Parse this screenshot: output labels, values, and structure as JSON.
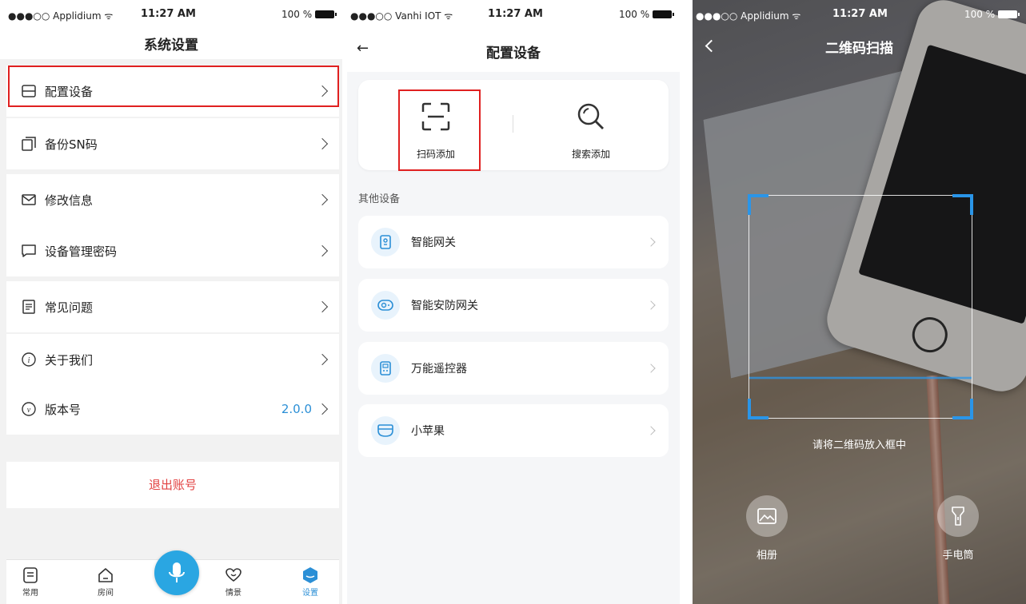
{
  "screen1": {
    "status": {
      "carrier": "●●●○○ Applidium ᯤ",
      "time": "11:27 AM",
      "battery": "100 %"
    },
    "title": "系统设置",
    "menu": [
      {
        "label": "配置设备",
        "icon": "device-icon"
      },
      {
        "label": "备份SN码",
        "icon": "copy-icon"
      },
      {
        "label": "修改信息",
        "icon": "mail-icon"
      },
      {
        "label": "设备管理密码",
        "icon": "message-icon"
      },
      {
        "label": "常见问题",
        "icon": "document-icon"
      },
      {
        "label": "关于我们",
        "icon": "info-icon"
      },
      {
        "label": "版本号",
        "icon": "version-icon",
        "value": "2.0.0"
      }
    ],
    "logout": "退出账号",
    "tabs": [
      {
        "label": "常用",
        "icon": "list-icon"
      },
      {
        "label": "房间",
        "icon": "home-icon"
      },
      {
        "label": "情景",
        "icon": "heart-icon"
      },
      {
        "label": "设置",
        "icon": "settings-icon",
        "active": true
      }
    ],
    "accent": "#2b8fd6",
    "highlight": "#e02020",
    "danger": "#e24141"
  },
  "screen2": {
    "status": {
      "carrier": "●●●○○ Vanhi IOT ᯤ",
      "time": "11:27 AM",
      "battery": "100 %"
    },
    "back": "←",
    "title": "配置设备",
    "add": [
      {
        "label": "扫码添加",
        "icon": "scan-icon"
      },
      {
        "label": "搜索添加",
        "icon": "search-icon"
      }
    ],
    "section": "其他设备",
    "devices": [
      {
        "label": "智能网关",
        "icon": "gateway-icon"
      },
      {
        "label": "智能安防网关",
        "icon": "camera-icon"
      },
      {
        "label": "万能遥控器",
        "icon": "remote-icon"
      },
      {
        "label": "小苹果",
        "icon": "device-icon"
      }
    ]
  },
  "screen3": {
    "status": {
      "carrier": "●●●○○ Applidium ᯤ",
      "time": "11:27 AM",
      "battery": "100 %"
    },
    "title": "二维码扫描",
    "hint": "请将二维码放入框中",
    "tools": [
      {
        "label": "相册",
        "icon": "image-icon"
      },
      {
        "label": "手电筒",
        "icon": "flashlight-icon"
      }
    ],
    "scan_color": "#2a95e8"
  }
}
